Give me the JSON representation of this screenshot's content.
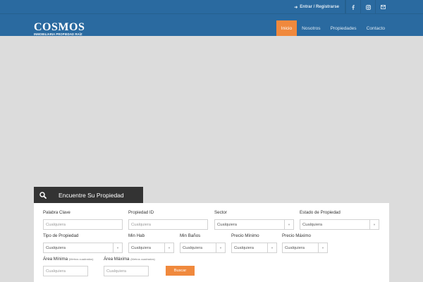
{
  "brand": {
    "logo": "COSMOS",
    "tagline": "INMOBILIARIA PROPIEDAD RAÍZ"
  },
  "topbar": {
    "login": "Entrar / Registrarse",
    "social": [
      "facebook-icon",
      "instagram-icon",
      "mail-icon"
    ]
  },
  "nav": {
    "items": [
      "Inicio",
      "Nosotros",
      "Propiedades",
      "Contacto"
    ],
    "active": "Inicio"
  },
  "search": {
    "title": "Encuentre Su Propiedad",
    "fields": {
      "keyword": {
        "label": "Palabra Clave",
        "placeholder": "Cualquiera"
      },
      "property_id": {
        "label": "Propiedad ID",
        "placeholder": "Cualquiera"
      },
      "sector": {
        "label": "Sector",
        "value": "Cualquiera"
      },
      "status": {
        "label": "Estado de Propiedad",
        "value": "Cualquiera"
      },
      "type": {
        "label": "Tipo de Propiedad",
        "value": "Cualquiera"
      },
      "min_rooms": {
        "label": "Min Hab",
        "value": "Cualquiera"
      },
      "min_baths": {
        "label": "Min Baños",
        "value": "Cualquiera"
      },
      "min_price": {
        "label": "Precio Mínimo",
        "value": "Cualquiera"
      },
      "max_price": {
        "label": "Precio Máximo",
        "value": "Cualquiera"
      },
      "min_area": {
        "label": "Área Mínima",
        "unit": "(Metros cuadrados)",
        "placeholder": "Cualquiera"
      },
      "max_area": {
        "label": "Área Máxima",
        "unit": "(Metros cuadrados)",
        "placeholder": "Cualquiera"
      }
    },
    "submit": "Buscar"
  },
  "colors": {
    "header": "#2a6aa0",
    "accent": "#f0893d",
    "tab": "#333333"
  }
}
